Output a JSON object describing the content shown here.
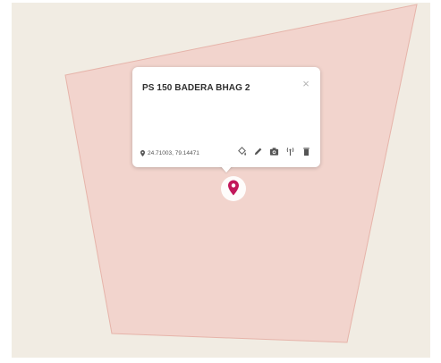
{
  "map": {
    "background_color": "#f1ece3",
    "polygon_fill": "#f2d4cd",
    "polygon_stroke": "#e6b4aa"
  },
  "popup": {
    "title": "PS 150 BADERA BHAG 2",
    "close_symbol": "×",
    "coordinates": "24.71003, 79.14471",
    "coords_icon": "map-pin-icon",
    "tools": [
      {
        "icon": "paint-bucket-icon"
      },
      {
        "icon": "pencil-icon"
      },
      {
        "icon": "camera-icon"
      },
      {
        "icon": "antenna-icon"
      },
      {
        "icon": "trash-icon"
      }
    ]
  },
  "marker": {
    "icon": "map-marker-icon",
    "color": "#c2185b"
  }
}
